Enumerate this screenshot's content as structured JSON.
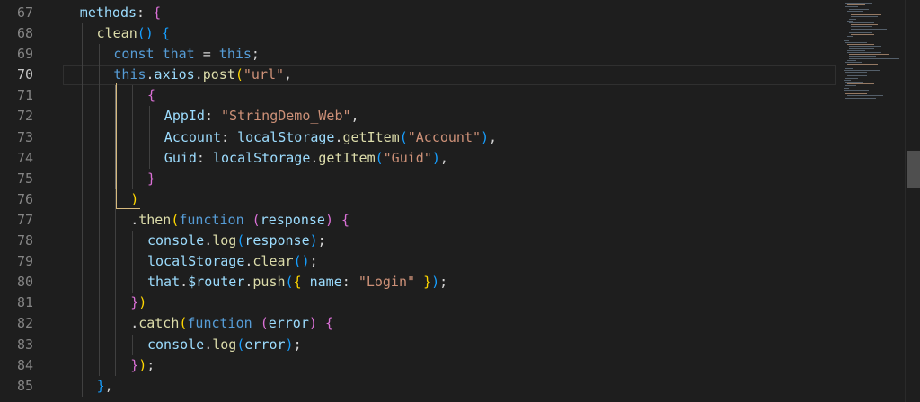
{
  "editor": {
    "line_numbers": [
      "67",
      "68",
      "69",
      "70",
      "71",
      "72",
      "73",
      "74",
      "75",
      "76",
      "77",
      "78",
      "79",
      "80",
      "81",
      "82",
      "83",
      "84",
      "85"
    ],
    "lines": [
      {
        "indent": 1,
        "tokens": [
          {
            "t": "methods",
            "c": "vr"
          },
          {
            "t": ": ",
            "c": "pl"
          },
          {
            "t": "{",
            "c": "b2"
          }
        ]
      },
      {
        "indent": 2,
        "tokens": [
          {
            "t": "clean",
            "c": "fn"
          },
          {
            "t": "()",
            "c": "b3"
          },
          {
            "t": " ",
            "c": "pl"
          },
          {
            "t": "{",
            "c": "b3"
          }
        ]
      },
      {
        "indent": 3,
        "tokens": [
          {
            "t": "const",
            "c": "kw"
          },
          {
            "t": " ",
            "c": "pl"
          },
          {
            "t": "that",
            "c": "kw"
          },
          {
            "t": " = ",
            "c": "pl"
          },
          {
            "t": "this",
            "c": "kw"
          },
          {
            "t": ";",
            "c": "pl"
          }
        ]
      },
      {
        "indent": 3,
        "tokens": [
          {
            "t": "this",
            "c": "kw"
          },
          {
            "t": ".",
            "c": "pl"
          },
          {
            "t": "axios",
            "c": "vr"
          },
          {
            "t": ".",
            "c": "pl"
          },
          {
            "t": "post",
            "c": "fn"
          },
          {
            "t": "(",
            "c": "b1"
          },
          {
            "t": "\"url\"",
            "c": "str"
          },
          {
            "t": ",",
            "c": "pl"
          }
        ]
      },
      {
        "indent": 5,
        "tokens": [
          {
            "t": "{",
            "c": "b2"
          }
        ]
      },
      {
        "indent": 6,
        "tokens": [
          {
            "t": "AppId",
            "c": "vr"
          },
          {
            "t": ": ",
            "c": "pl"
          },
          {
            "t": "\"StringDemo_Web\"",
            "c": "str"
          },
          {
            "t": ",",
            "c": "pl"
          }
        ]
      },
      {
        "indent": 6,
        "tokens": [
          {
            "t": "Account",
            "c": "vr"
          },
          {
            "t": ": ",
            "c": "pl"
          },
          {
            "t": "localStorage",
            "c": "vr"
          },
          {
            "t": ".",
            "c": "pl"
          },
          {
            "t": "getItem",
            "c": "fn"
          },
          {
            "t": "(",
            "c": "b3"
          },
          {
            "t": "\"Account\"",
            "c": "str"
          },
          {
            "t": ")",
            "c": "b3"
          },
          {
            "t": ",",
            "c": "pl"
          }
        ]
      },
      {
        "indent": 6,
        "tokens": [
          {
            "t": "Guid",
            "c": "vr"
          },
          {
            "t": ": ",
            "c": "pl"
          },
          {
            "t": "localStorage",
            "c": "vr"
          },
          {
            "t": ".",
            "c": "pl"
          },
          {
            "t": "getItem",
            "c": "fn"
          },
          {
            "t": "(",
            "c": "b3"
          },
          {
            "t": "\"Guid\"",
            "c": "str"
          },
          {
            "t": ")",
            "c": "b3"
          },
          {
            "t": ",",
            "c": "pl"
          }
        ]
      },
      {
        "indent": 5,
        "tokens": [
          {
            "t": "}",
            "c": "b2"
          }
        ]
      },
      {
        "indent": 4,
        "tokens": [
          {
            "t": ")",
            "c": "b1"
          }
        ]
      },
      {
        "indent": 4,
        "tokens": [
          {
            "t": ".",
            "c": "pl"
          },
          {
            "t": "then",
            "c": "fn"
          },
          {
            "t": "(",
            "c": "b1"
          },
          {
            "t": "function",
            "c": "kw"
          },
          {
            "t": " ",
            "c": "pl"
          },
          {
            "t": "(",
            "c": "b2"
          },
          {
            "t": "response",
            "c": "vr"
          },
          {
            "t": ")",
            "c": "b2"
          },
          {
            "t": " ",
            "c": "pl"
          },
          {
            "t": "{",
            "c": "b2"
          }
        ]
      },
      {
        "indent": 5,
        "tokens": [
          {
            "t": "console",
            "c": "vr"
          },
          {
            "t": ".",
            "c": "pl"
          },
          {
            "t": "log",
            "c": "fn"
          },
          {
            "t": "(",
            "c": "b3"
          },
          {
            "t": "response",
            "c": "vr"
          },
          {
            "t": ")",
            "c": "b3"
          },
          {
            "t": ";",
            "c": "pl"
          }
        ]
      },
      {
        "indent": 5,
        "tokens": [
          {
            "t": "localStorage",
            "c": "vr"
          },
          {
            "t": ".",
            "c": "pl"
          },
          {
            "t": "clear",
            "c": "fn"
          },
          {
            "t": "()",
            "c": "b3"
          },
          {
            "t": ";",
            "c": "pl"
          }
        ]
      },
      {
        "indent": 5,
        "tokens": [
          {
            "t": "that",
            "c": "vr"
          },
          {
            "t": ".",
            "c": "pl"
          },
          {
            "t": "$router",
            "c": "vr"
          },
          {
            "t": ".",
            "c": "pl"
          },
          {
            "t": "push",
            "c": "fn"
          },
          {
            "t": "(",
            "c": "b3"
          },
          {
            "t": "{",
            "c": "b1"
          },
          {
            "t": " ",
            "c": "pl"
          },
          {
            "t": "name",
            "c": "vr"
          },
          {
            "t": ": ",
            "c": "pl"
          },
          {
            "t": "\"Login\"",
            "c": "str"
          },
          {
            "t": " ",
            "c": "pl"
          },
          {
            "t": "}",
            "c": "b1"
          },
          {
            "t": ")",
            "c": "b3"
          },
          {
            "t": ";",
            "c": "pl"
          }
        ]
      },
      {
        "indent": 4,
        "tokens": [
          {
            "t": "}",
            "c": "b2"
          },
          {
            "t": ")",
            "c": "b1"
          }
        ]
      },
      {
        "indent": 4,
        "tokens": [
          {
            "t": ".",
            "c": "pl"
          },
          {
            "t": "catch",
            "c": "fn"
          },
          {
            "t": "(",
            "c": "b1"
          },
          {
            "t": "function",
            "c": "kw"
          },
          {
            "t": " ",
            "c": "pl"
          },
          {
            "t": "(",
            "c": "b2"
          },
          {
            "t": "error",
            "c": "vr"
          },
          {
            "t": ")",
            "c": "b2"
          },
          {
            "t": " ",
            "c": "pl"
          },
          {
            "t": "{",
            "c": "b2"
          }
        ]
      },
      {
        "indent": 5,
        "tokens": [
          {
            "t": "console",
            "c": "vr"
          },
          {
            "t": ".",
            "c": "pl"
          },
          {
            "t": "log",
            "c": "fn"
          },
          {
            "t": "(",
            "c": "b3"
          },
          {
            "t": "error",
            "c": "vr"
          },
          {
            "t": ")",
            "c": "b3"
          },
          {
            "t": ";",
            "c": "pl"
          }
        ]
      },
      {
        "indent": 4,
        "tokens": [
          {
            "t": "}",
            "c": "b2"
          },
          {
            "t": ")",
            "c": "b1"
          },
          {
            "t": ";",
            "c": "pl"
          }
        ]
      },
      {
        "indent": 2,
        "tokens": [
          {
            "t": "}",
            "c": "b3"
          },
          {
            "t": ",",
            "c": "pl"
          }
        ]
      }
    ],
    "current_line": "70",
    "colors": {
      "background": "#1e1e1e",
      "keyword": "#569cd6",
      "function": "#dcdcaa",
      "variable": "#9cdcfe",
      "string": "#ce9178",
      "bracket_1": "#ffd700",
      "bracket_2": "#da70d6",
      "bracket_3": "#179fff",
      "bracket_match_box": "#d7ba7d"
    }
  }
}
